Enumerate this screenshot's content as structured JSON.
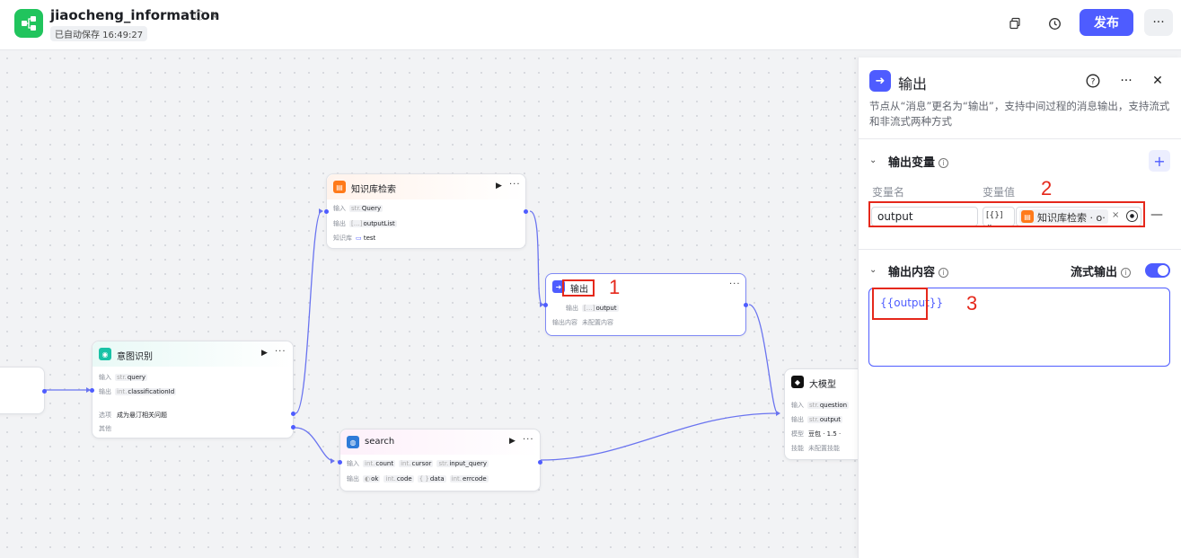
{
  "header": {
    "title": "jiaocheng_information",
    "autosave": "已自动保存 16:49:27",
    "publish_label": "发布",
    "more_label": "···"
  },
  "nodes": {
    "knowledge": {
      "title": "知识库检索",
      "input_label": "输入",
      "input_type": "str.",
      "input_value": "Query",
      "output_label": "输出",
      "output_type": "[…]",
      "output_value": "outputList",
      "kb_label": "知识库",
      "kb_value": "test"
    },
    "output": {
      "title": "输出",
      "output_label": "输出",
      "output_type": "[…]",
      "output_value": "output",
      "content_label": "输出内容",
      "content_value": "未配置内容"
    },
    "intent": {
      "title": "意图识别",
      "input_label": "输入",
      "input_type": "str.",
      "input_value": "query",
      "output_label": "输出",
      "output_type": "int.",
      "output_value": "classificationId",
      "option_label": "选项",
      "option_value": "成为悬汀相关问题",
      "other_label": "其他"
    },
    "search": {
      "title": "search",
      "input_label": "输入",
      "inputs": [
        {
          "type": "int.",
          "name": "count"
        },
        {
          "type": "int.",
          "name": "cursor"
        },
        {
          "type": "str.",
          "name": "input_query"
        }
      ],
      "output_label": "输出",
      "outputs": [
        {
          "type": "◐",
          "name": "ok"
        },
        {
          "type": "int.",
          "name": "code"
        },
        {
          "type": "{ }",
          "name": "data"
        },
        {
          "type": "int.",
          "name": "errcode"
        }
      ]
    },
    "llm": {
      "title": "大模型",
      "input_label": "输入",
      "input_type": "str.",
      "input_value": "question",
      "output_label": "输出",
      "output_type": "str.",
      "output_value": "output",
      "model_label": "模型",
      "model_value": "豆包 · 1.5 ·",
      "skill_label": "技能",
      "skill_value": "未配置技能"
    }
  },
  "panel": {
    "title": "输出",
    "description": "节点从“消息”更名为“输出”，支持中间过程的消息输出，支持流式和非流式两种方式",
    "section_vars": "输出变量",
    "col_name": "变量名",
    "col_value": "变量值",
    "var_name_value": "output",
    "var_type": "[{}]",
    "ref_label": "知识库检索 · o·",
    "section_content": "输出内容",
    "stream_label": "流式输出",
    "stream_on": true,
    "editor_value": "{{output}}"
  },
  "annotations": {
    "n1": "1",
    "n2": "2",
    "n3": "3"
  },
  "colors": {
    "accent": "#4e5cff",
    "annotation": "#e5281b",
    "logo": "#21c45d",
    "knowledge_icon": "#ff7a1a"
  }
}
